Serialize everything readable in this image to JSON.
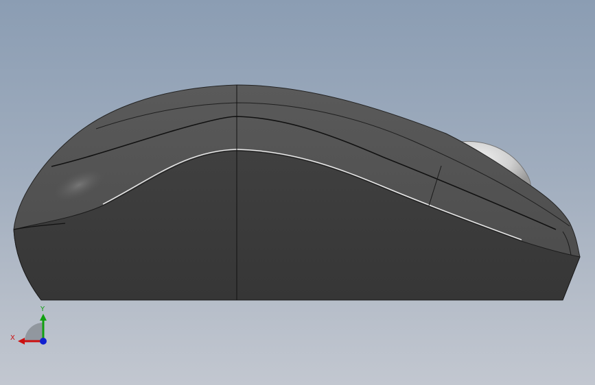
{
  "viewport": {
    "model": "mouse-side-view"
  },
  "triad": {
    "x_label": "X",
    "y_label": "Y",
    "x_color": "#cc1010",
    "y_color": "#10a010",
    "z_color": "#1020d0"
  },
  "colors": {
    "background_top": "#8b9db3",
    "background_bottom": "#c2c7d0",
    "body_dark": "#3a3a3a",
    "shell_mid": "#555555",
    "wheel": "#d0d0d0"
  }
}
